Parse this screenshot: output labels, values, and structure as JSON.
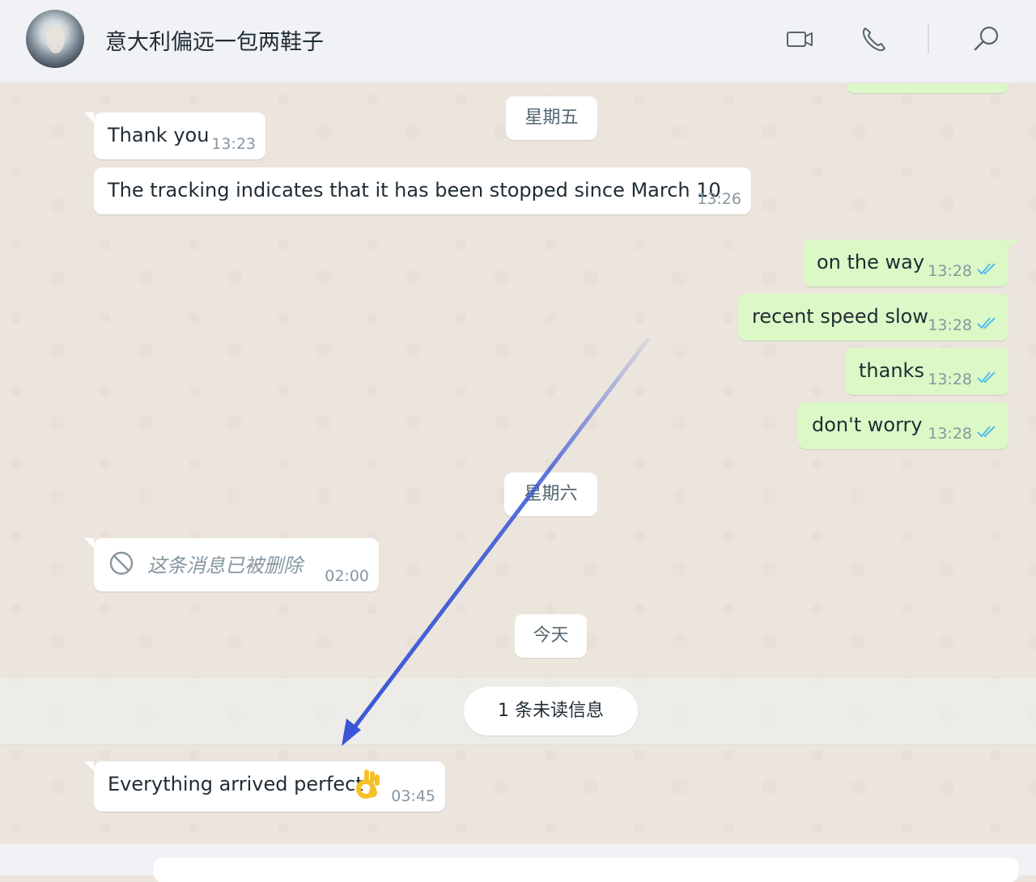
{
  "header": {
    "title": "意大利偏远一包两鞋子",
    "icons": [
      "video-camera-icon",
      "phone-icon",
      "search-icon"
    ]
  },
  "dates": {
    "friday": "星期五",
    "saturday": "星期六",
    "today": "今天",
    "unread": "1 条未读信息"
  },
  "messages": [
    {
      "dir": "in",
      "text": "Thank you",
      "time": "13:23"
    },
    {
      "dir": "in",
      "text": "The tracking indicates that it has been stopped since March 10",
      "time": "13:26"
    },
    {
      "dir": "out",
      "text": "on the way",
      "time": "13:28",
      "status": "read"
    },
    {
      "dir": "out",
      "text": "recent speed slow",
      "time": "13:28",
      "status": "read"
    },
    {
      "dir": "out",
      "text": "thanks",
      "time": "13:28",
      "status": "read"
    },
    {
      "dir": "out",
      "text": "don't worry",
      "time": "13:28",
      "status": "read"
    },
    {
      "dir": "in",
      "deleted": true,
      "text": "这条消息已被删除",
      "time": "02:00"
    },
    {
      "dir": "in",
      "text": "Everything arrived perfect",
      "emoji": "ok-hand",
      "time": "03:45"
    }
  ],
  "colors": {
    "incoming": "#ffffff",
    "outgoing": "#dcf8c6",
    "read_ticks": "#53bdeb",
    "annotation_arrow": "#3a56d6"
  }
}
